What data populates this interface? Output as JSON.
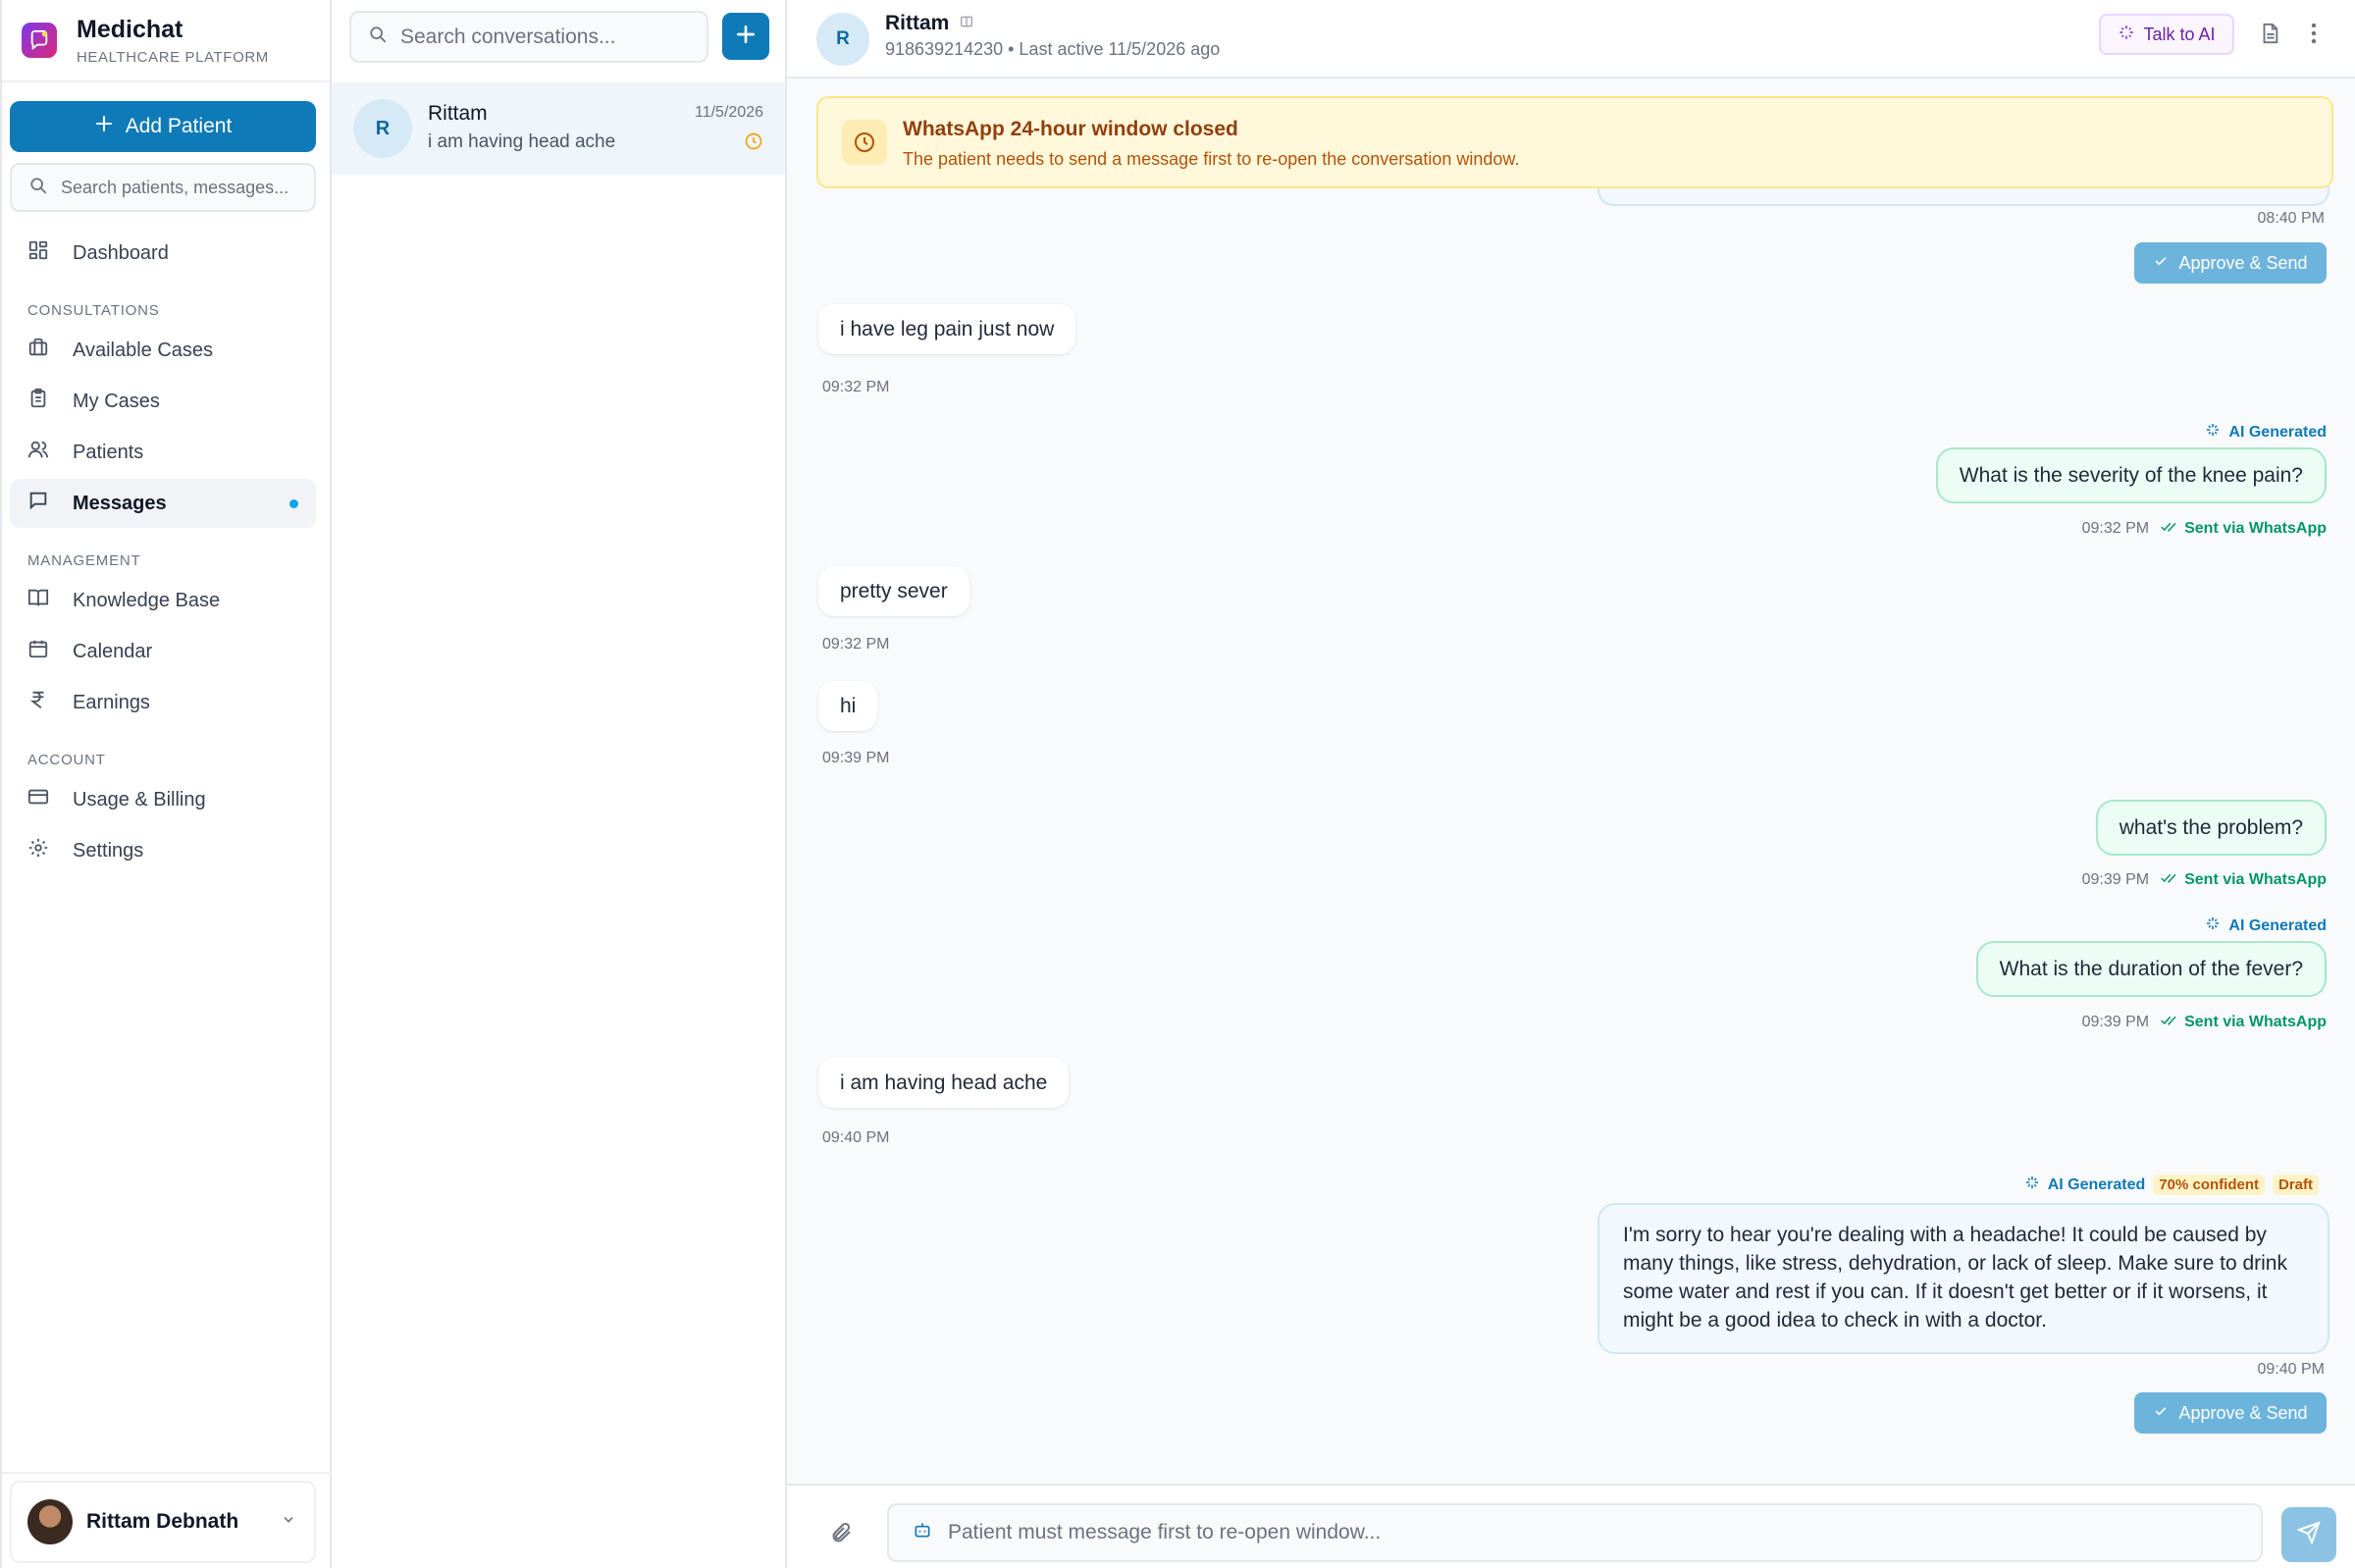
{
  "brand": {
    "name": "Medichat",
    "subtitle": "HEALTHCARE PLATFORM"
  },
  "sidebar": {
    "add_patient": "Add Patient",
    "search_placeholder": "Search patients, messages...",
    "dashboard": "Dashboard",
    "sections": {
      "consultations": "CONSULTATIONS",
      "management": "MANAGEMENT",
      "account": "ACCOUNT"
    },
    "items": {
      "available_cases": "Available Cases",
      "my_cases": "My Cases",
      "patients": "Patients",
      "messages": "Messages",
      "knowledge_base": "Knowledge Base",
      "calendar": "Calendar",
      "earnings": "Earnings",
      "usage_billing": "Usage & Billing",
      "settings": "Settings"
    },
    "user": "Rittam Debnath"
  },
  "conversations": {
    "search_placeholder": "Search conversations...",
    "items": [
      {
        "initial": "R",
        "name": "Rittam",
        "preview": "i am having head ache",
        "date": "11/5/2026"
      }
    ]
  },
  "chat": {
    "header": {
      "initial": "R",
      "name": "Rittam",
      "subtitle": "918639214230 • Last active 11/5/2026 ago",
      "talk_ai": "Talk to AI"
    },
    "banner": {
      "title": "WhatsApp 24-hour window closed",
      "subtitle": "The patient needs to send a message first to re-open the conversation window."
    },
    "approve_label": "Approve & Send",
    "ai_label": "AI Generated",
    "sent_label": "Sent via WhatsApp",
    "messages": {
      "m0_time": "08:40 PM",
      "m1_text": "i have leg pain just now",
      "m1_time": "09:32 PM",
      "m2_text": "What is the severity of the knee pain?",
      "m2_time": "09:32 PM",
      "m3_text": "pretty sever",
      "m3_time": "09:32 PM",
      "m4_text": "hi",
      "m4_time": "09:39 PM",
      "m5_text": "what's the problem?",
      "m5_time": "09:39 PM",
      "m6_text": "What is the duration of the fever?",
      "m6_time": "09:39 PM",
      "m7_text": "i am having head ache",
      "m7_time": "09:40 PM",
      "m8_text": "I'm sorry to hear you're dealing with a headache! It could be caused by many things, like stress, dehydration, or lack of sleep. Make sure to drink some water and rest if you can. If it doesn't get better or if it worsens, it might be a good idea to check in with a doctor.",
      "m8_time": "09:40 PM",
      "m8_confidence": "70% confident",
      "m8_status": "Draft"
    },
    "composer_placeholder": "Patient must message first to re-open window..."
  },
  "colors": {
    "accent": "#0e7ab8",
    "banner_bg": "#fff8db",
    "wa_green": "#059669"
  }
}
